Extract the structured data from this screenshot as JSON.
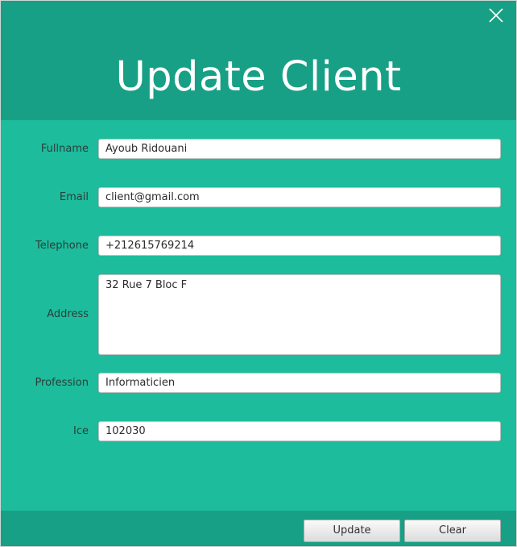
{
  "window": {
    "title": "Update Client",
    "close_icon": "close-icon",
    "colors": {
      "header": "#17a085",
      "body": "#1dbc9c",
      "footer": "#17a085"
    }
  },
  "form": {
    "fullname": {
      "label": "Fullname",
      "value": "Ayoub Ridouani"
    },
    "email": {
      "label": "Email",
      "value": "client@gmail.com"
    },
    "telephone": {
      "label": "Telephone",
      "value": "+212615769214"
    },
    "address": {
      "label": "Address",
      "value": "32 Rue 7 Bloc F"
    },
    "profession": {
      "label": "Profession",
      "value": "Informaticien"
    },
    "ice": {
      "label": "Ice",
      "value": "102030"
    }
  },
  "actions": {
    "update_label": "Update",
    "clear_label": "Clear"
  }
}
